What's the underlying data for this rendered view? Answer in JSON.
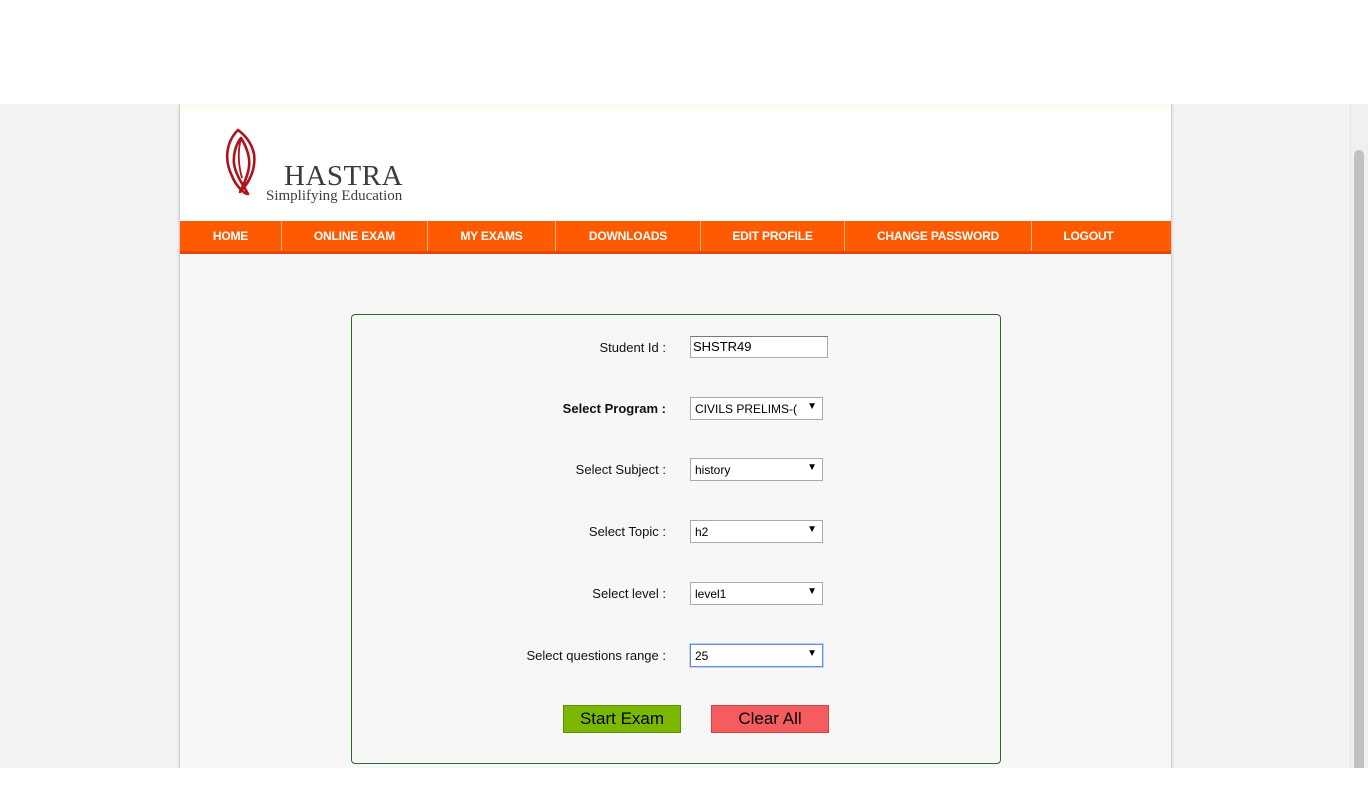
{
  "brand": {
    "name": "HASTRA",
    "tagline": "Simplifying Education"
  },
  "colors": {
    "nav_bg": "#ff5a00",
    "panel_border": "#2e6a2e",
    "start_button": "#7ab800",
    "clear_button": "#f45c60",
    "logo_mark": "#b0121b"
  },
  "nav": {
    "items": [
      {
        "label": "HOME"
      },
      {
        "label": "ONLINE EXAM"
      },
      {
        "label": "MY EXAMS"
      },
      {
        "label": "DOWNLOADS"
      },
      {
        "label": "EDIT PROFILE"
      },
      {
        "label": "CHANGE PASSWORD"
      },
      {
        "label": "LOGOUT"
      }
    ]
  },
  "form": {
    "student_id": {
      "label": "Student Id :",
      "value": "SHSTR49"
    },
    "program": {
      "label": "Select Program :",
      "value": "CIVILS PRELIMS-("
    },
    "subject": {
      "label": "Select Subject :",
      "value": "history"
    },
    "topic": {
      "label": "Select Topic :",
      "value": "h2"
    },
    "level": {
      "label": "Select level :",
      "value": "level1"
    },
    "questions_range": {
      "label": "Select questions range :",
      "value": "25"
    },
    "start_label": "Start Exam",
    "clear_label": "Clear All"
  }
}
